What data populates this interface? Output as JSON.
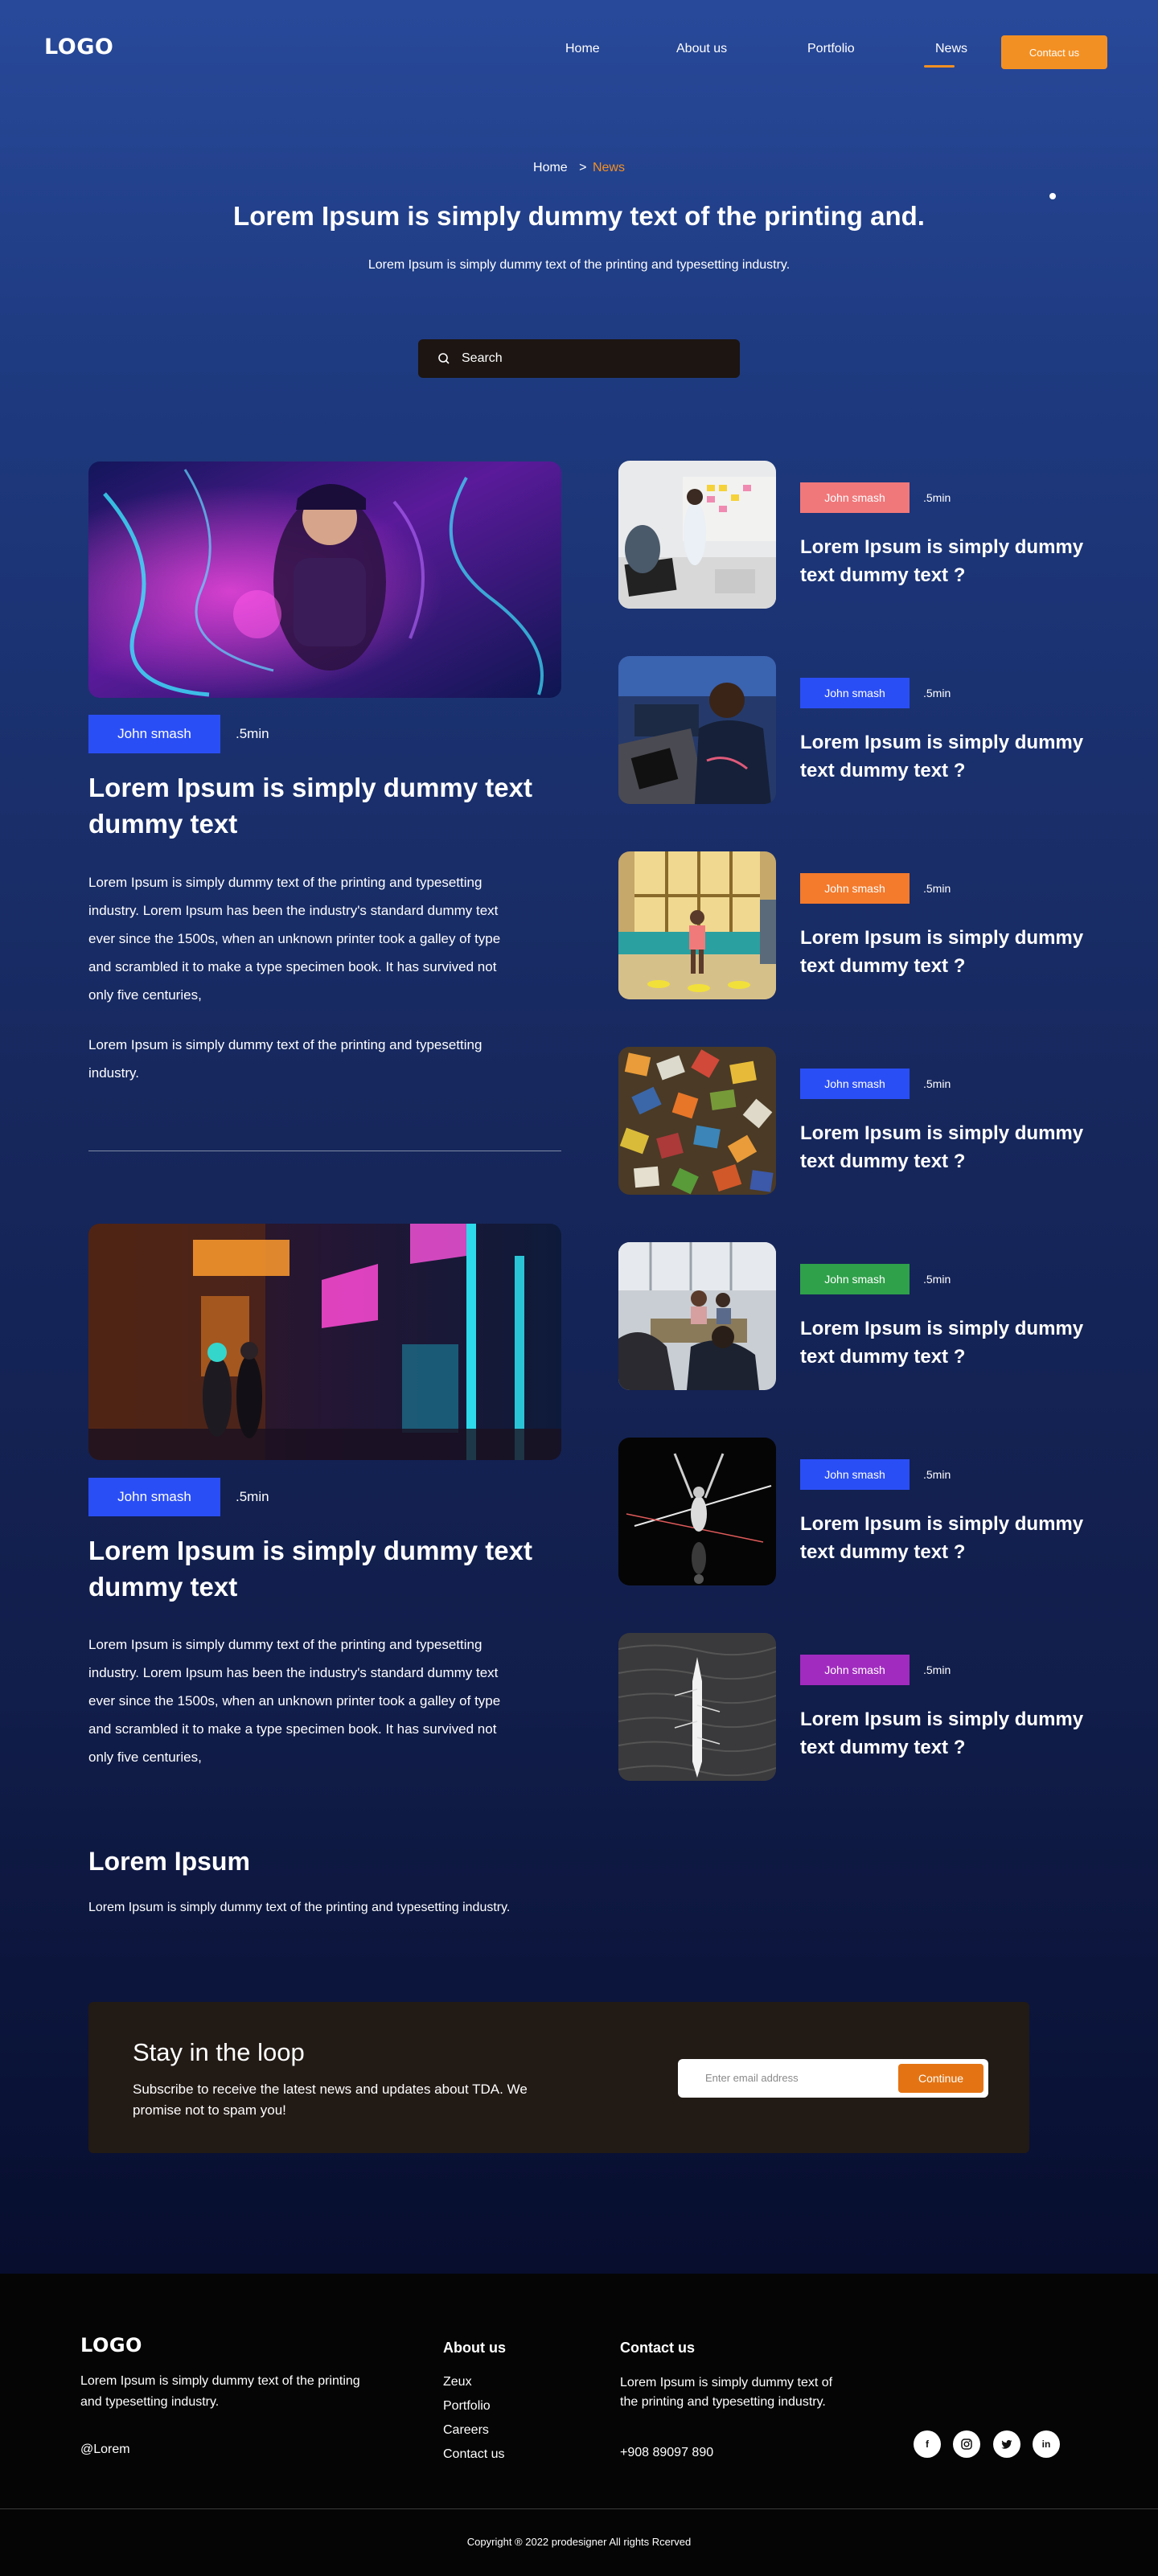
{
  "header": {
    "logo": "LOGO",
    "nav": [
      "Home",
      "About us",
      "Portfolio",
      "News"
    ],
    "active_nav": "News",
    "contact_button": "Contact us"
  },
  "hero": {
    "breadcrumb_home": "Home",
    "breadcrumb_sep": ">",
    "breadcrumb_current": "News",
    "title": "Lorem Ipsum is simply dummy text of the printing and.",
    "subtitle": "Lorem Ipsum is simply dummy text of the printing and typesetting industry.",
    "search_placeholder": "Search"
  },
  "featured": [
    {
      "tag": "John smash",
      "read_time": ".5min",
      "title": "Lorem Ipsum is simply dummy text dummy text",
      "paragraph1": "Lorem Ipsum is simply dummy text of the printing and typesetting industry. Lorem Ipsum has been the industry's standard dummy text ever since the 1500s, when an unknown printer took a galley of type and scrambled it to make a type specimen book. It has survived not only five centuries,",
      "paragraph2": "Lorem Ipsum is simply dummy text of the printing and typesetting industry."
    },
    {
      "tag": "John smash",
      "read_time": ".5min",
      "title": "Lorem Ipsum is simply dummy text dummy text",
      "paragraph1": "Lorem Ipsum is simply dummy text of the printing and typesetting industry. Lorem Ipsum has been the industry's standard dummy text ever since the 1500s, when an unknown printer took a galley of type and scrambled it to make a type specimen book. It has survived not only five centuries,"
    }
  ],
  "side_articles": [
    {
      "tag": "John smash",
      "tag_color": "#f0787a",
      "read_time": ".5min",
      "title": "Lorem Ipsum is simply dummy text dummy text ?"
    },
    {
      "tag": "John smash",
      "tag_color": "#2a4ef5",
      "read_time": ".5min",
      "title": "Lorem Ipsum is simply dummy text dummy text ?"
    },
    {
      "tag": "John smash",
      "tag_color": "#f47a2c",
      "read_time": ".5min",
      "title": "Lorem Ipsum is simply dummy text dummy text ?"
    },
    {
      "tag": "John smash",
      "tag_color": "#2a4ef5",
      "read_time": ".5min",
      "title": "Lorem Ipsum is simply dummy text dummy text ?"
    },
    {
      "tag": "John smash",
      "tag_color": "#2fa14a",
      "read_time": ".5min",
      "title": "Lorem Ipsum is simply dummy text dummy text ?"
    },
    {
      "tag": "John smash",
      "tag_color": "#2a4ef5",
      "read_time": ".5min",
      "title": "Lorem Ipsum is simply dummy text dummy text ?"
    },
    {
      "tag": "John smash",
      "tag_color": "#a12bbf",
      "read_time": ".5min",
      "title": "Lorem Ipsum is simply dummy text dummy text ?"
    }
  ],
  "info": {
    "heading": "Lorem Ipsum",
    "text": "Lorem Ipsum is simply dummy text of the printing and typesetting industry."
  },
  "newsletter": {
    "title": "Stay in the loop",
    "text": "Subscribe to receive the latest news and updates about TDA. We promise not to spam you!",
    "email_placeholder": "Enter email address",
    "button": "Continue"
  },
  "footer": {
    "logo": "LOGO",
    "description": "Lorem Ipsum is simply dummy text of the printing and typesetting industry.",
    "handle": "@Lorem",
    "about_heading": "About us",
    "about_links": [
      "Zeux",
      "Portfolio",
      "Careers",
      "Contact us"
    ],
    "contact_heading": "Contact us",
    "contact_text": "Lorem Ipsum is simply dummy text of the printing and typesetting industry.",
    "phone": "+908 89097 890",
    "socials": [
      "facebook-icon",
      "instagram-icon",
      "twitter-icon",
      "linkedin-icon"
    ],
    "copyright": "Copyright ® 2022 prodesigner All rights Rcerved"
  },
  "colors": {
    "accent": "#f39023",
    "tag_blue": "#2a4ef5",
    "newsletter_bg": "#221a15",
    "footer_bg": "#050505"
  }
}
